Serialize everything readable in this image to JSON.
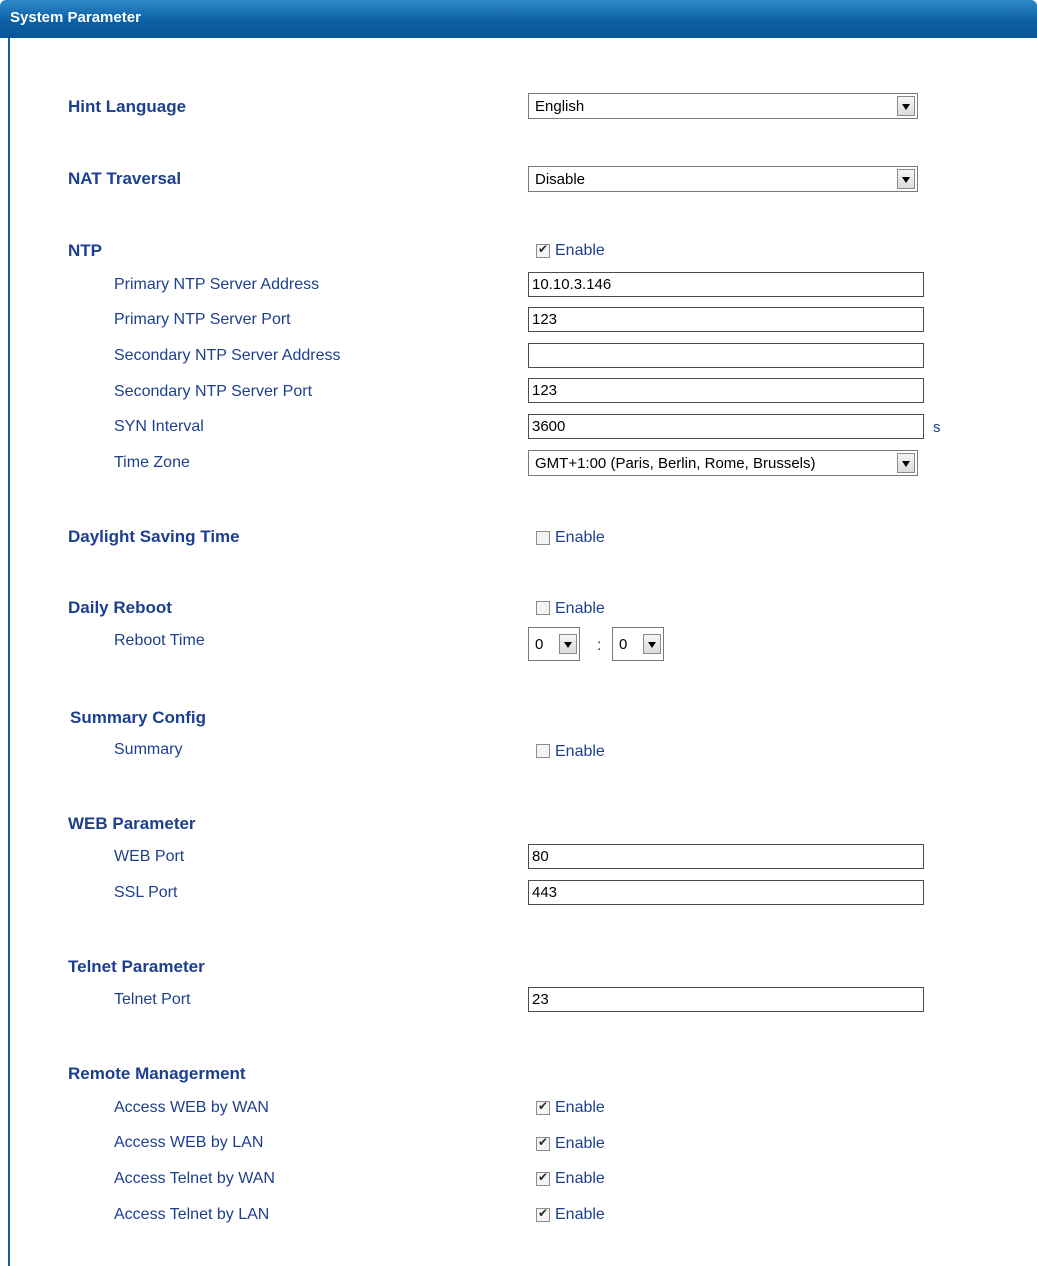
{
  "header": {
    "title": "System Parameter"
  },
  "hint_language": {
    "label": "Hint Language",
    "value": "English"
  },
  "nat": {
    "label": "NAT Traversal",
    "value": "Disable"
  },
  "ntp": {
    "label": "NTP",
    "enable_label": "Enable",
    "enabled": true,
    "primary_addr_label": "Primary NTP Server Address",
    "primary_addr": "10.10.3.146",
    "primary_port_label": "Primary NTP Server Port",
    "primary_port": "123",
    "secondary_addr_label": "Secondary NTP Server Address",
    "secondary_addr": "",
    "secondary_port_label": "Secondary NTP Server Port",
    "secondary_port": "123",
    "syn_label": "SYN Interval",
    "syn": "3600",
    "syn_unit": "s",
    "tz_label": "Time Zone",
    "tz": "GMT+1:00 (Paris, Berlin, Rome, Brussels)"
  },
  "dst": {
    "label": "Daylight Saving Time",
    "enable_label": "Enable",
    "enabled": false
  },
  "reboot": {
    "label": "Daily Reboot",
    "enable_label": "Enable",
    "enabled": false,
    "time_label": "Reboot Time",
    "hour": "0",
    "sep": ":",
    "minute": "0"
  },
  "summary": {
    "label": "Summary Config",
    "sub_label": "Summary",
    "enable_label": "Enable",
    "enabled": false
  },
  "web": {
    "label": "WEB Parameter",
    "web_port_label": "WEB Port",
    "web_port": "80",
    "ssl_port_label": "SSL Port",
    "ssl_port": "443"
  },
  "telnet": {
    "label": "Telnet Parameter",
    "port_label": "Telnet Port",
    "port": "23"
  },
  "remote": {
    "label": "Remote Managerment",
    "enable_label": "Enable",
    "items": [
      {
        "label": "Access WEB by WAN",
        "enabled": true
      },
      {
        "label": "Access WEB by LAN",
        "enabled": true
      },
      {
        "label": "Access Telnet by WAN",
        "enabled": true
      },
      {
        "label": "Access Telnet by LAN",
        "enabled": true
      }
    ]
  }
}
